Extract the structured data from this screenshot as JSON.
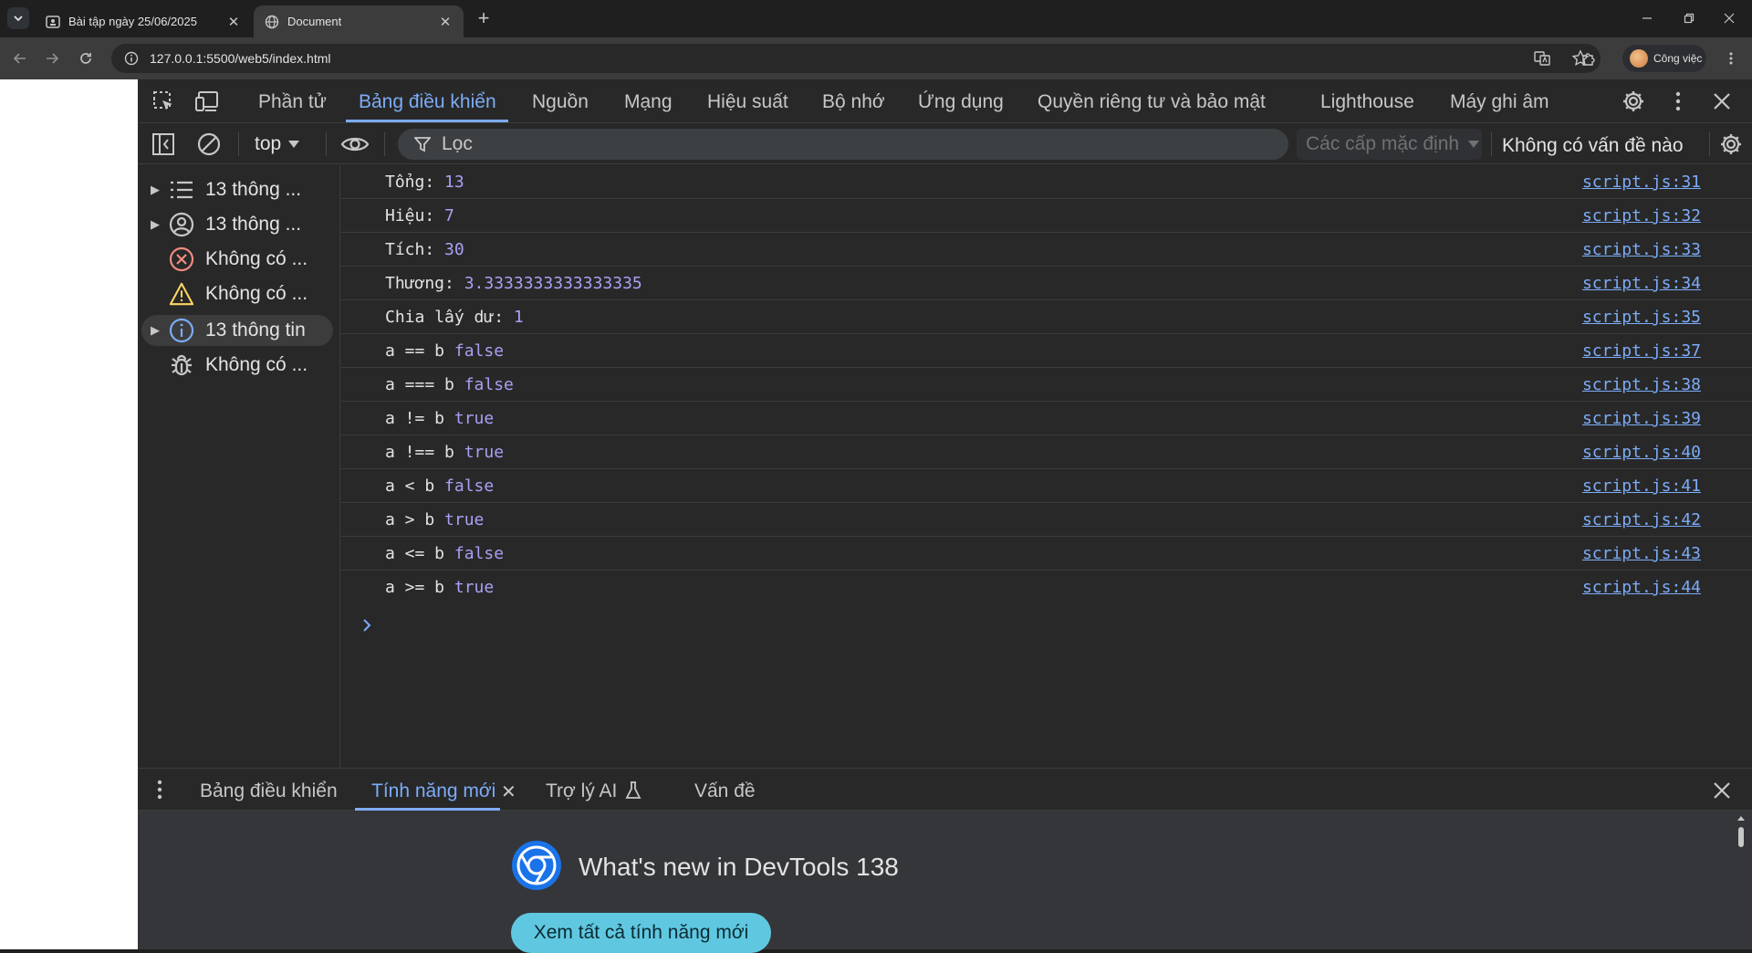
{
  "browser": {
    "tabs": [
      {
        "title": "Bài tập ngày 25/06/2025"
      },
      {
        "title": "Document"
      }
    ],
    "url": "127.0.0.1:5500/web5/index.html",
    "profile_label": "Công việc"
  },
  "devtools": {
    "panels": [
      "Phần tử",
      "Bảng điều khiển",
      "Nguồn",
      "Mạng",
      "Hiệu suất",
      "Bộ nhớ",
      "Ứng dụng",
      "Quyền riêng tư và bảo mật",
      "Lighthouse",
      "Máy ghi âm"
    ],
    "active_panel": "Bảng điều khiển",
    "toolbar": {
      "context": "top",
      "filter_placeholder": "Lọc",
      "levels": "Các cấp mặc định",
      "issues": "Không có vấn đề nào"
    },
    "sidebar": [
      {
        "label": "13 thông ...",
        "icon": "list-icon",
        "expandable": true
      },
      {
        "label": "13 thông ...",
        "icon": "user-icon",
        "expandable": true
      },
      {
        "label": "Không có ...",
        "icon": "error-icon",
        "expandable": false
      },
      {
        "label": "Không có ...",
        "icon": "warning-icon",
        "expandable": false
      },
      {
        "label": "13 thông tin",
        "icon": "info-icon",
        "expandable": true,
        "selected": true
      },
      {
        "label": "Không có ...",
        "icon": "bug-icon",
        "expandable": false
      }
    ],
    "console": [
      {
        "text": "Tổng: ",
        "value": "13",
        "source": "script.js:31"
      },
      {
        "text": "Hiệu: ",
        "value": "7",
        "source": "script.js:32"
      },
      {
        "text": "Tích: ",
        "value": "30",
        "source": "script.js:33"
      },
      {
        "text": "Thương: ",
        "value": "3.3333333333333335",
        "source": "script.js:34"
      },
      {
        "text": "Chia lấy dư: ",
        "value": "1",
        "source": "script.js:35"
      },
      {
        "text": "a == b ",
        "value": "false",
        "source": "script.js:37"
      },
      {
        "text": "a === b ",
        "value": "false",
        "source": "script.js:38"
      },
      {
        "text": "a != b ",
        "value": "true",
        "source": "script.js:39"
      },
      {
        "text": "a !== b ",
        "value": "true",
        "source": "script.js:40"
      },
      {
        "text": "a < b ",
        "value": "false",
        "source": "script.js:41"
      },
      {
        "text": "a > b ",
        "value": "true",
        "source": "script.js:42"
      },
      {
        "text": "a <= b ",
        "value": "false",
        "source": "script.js:43"
      },
      {
        "text": "a >= b ",
        "value": "true",
        "source": "script.js:44"
      }
    ],
    "drawer": {
      "tabs": [
        "Bảng điều khiển",
        "Tính năng mới",
        "Trợ lý AI",
        "Vấn đề"
      ],
      "active_tab": "Tính năng mới",
      "whats_new_title": "What's new in DevTools 138",
      "whats_new_button": "Xem tất cả tính năng mới"
    }
  },
  "colors": {
    "accent": "#7cacf8",
    "value": "#a8a0f4",
    "button": "#5fc8e0",
    "error": "#f28b82",
    "warning": "#fdd663"
  }
}
